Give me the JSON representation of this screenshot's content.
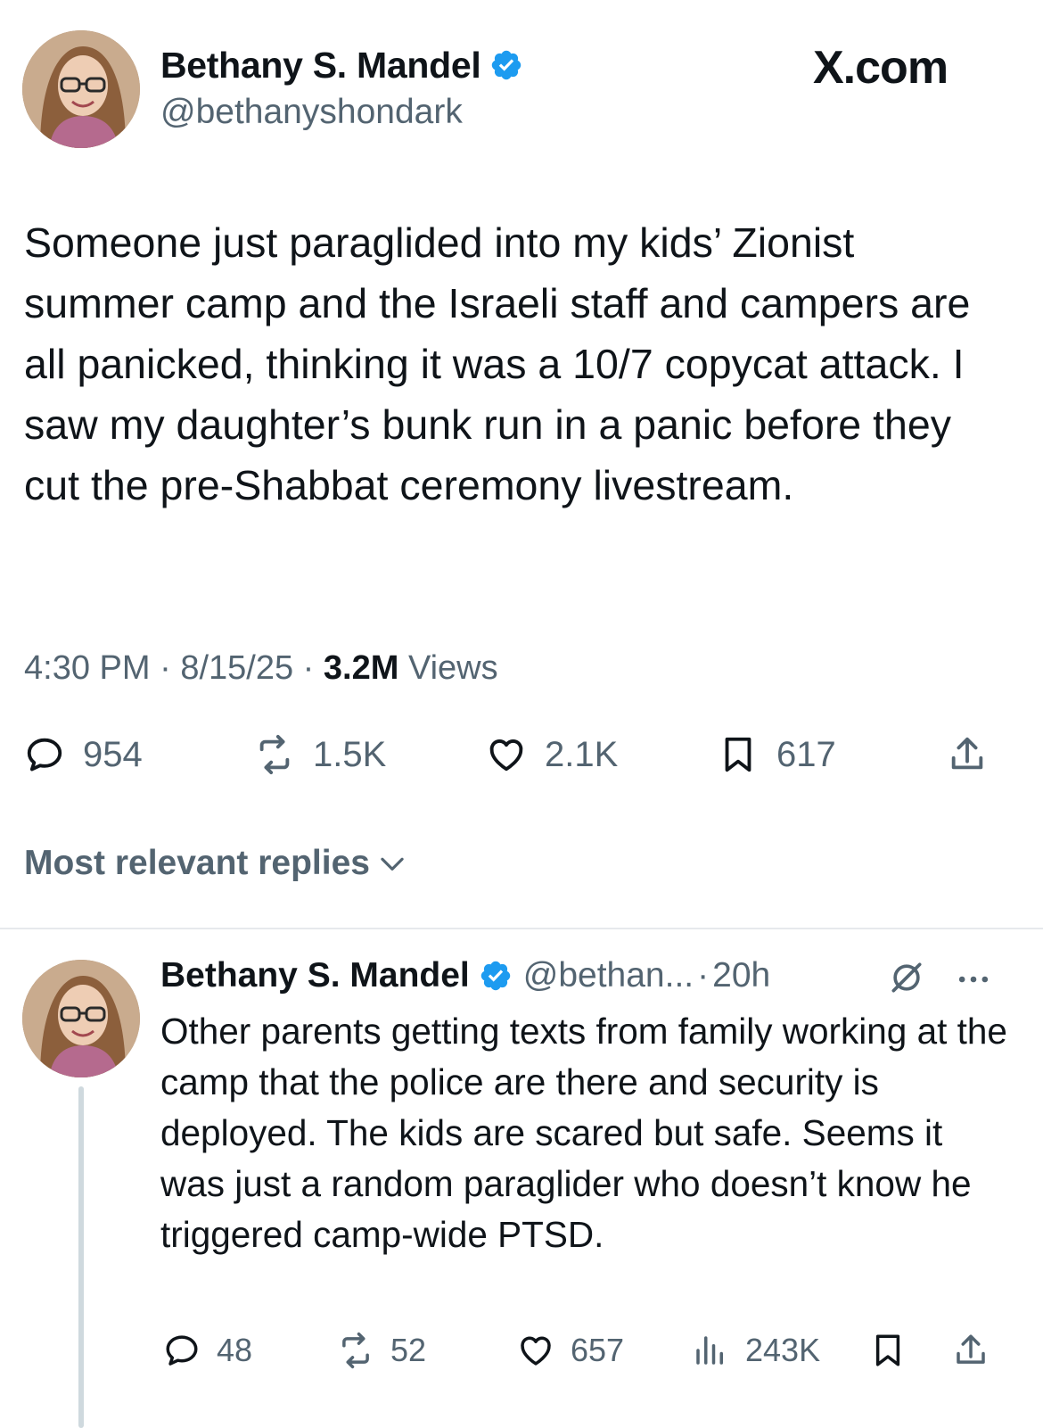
{
  "tweet": {
    "author_name": "Bethany S. Mandel",
    "author_handle": "@bethanyshondark",
    "brand": "X.com",
    "text": "Someone just paraglided into my kids’ Zionist summer camp and the Israeli staff and campers are all panicked, thinking it was a 10/7 copycat attack. I saw my daughter’s bunk run in a panic before they cut the pre-Shabbat ceremony livestream.",
    "time": "4:30 PM",
    "date": "8/15/25",
    "views_count": "3.2M",
    "views_label": "Views",
    "separator": "·",
    "actions": {
      "replies": "954",
      "reposts": "1.5K",
      "likes": "2.1K",
      "bookmarks": "617"
    }
  },
  "replies_section": {
    "label": "Most relevant replies"
  },
  "reply": {
    "author_name": "Bethany S. Mandel",
    "author_handle": "@bethan...",
    "age": "20h",
    "text": "Other parents getting texts from family working at the camp that the police are there and security is deployed. The kids are scared but safe. Seems it was just a random paraglider who doesn’t know he triggered camp-wide PTSD.",
    "actions": {
      "replies": "48",
      "reposts": "52",
      "likes": "657",
      "views": "243K"
    }
  },
  "colors": {
    "verified_blue": "#1d9bf0",
    "muted_gray": "#536471",
    "text": "#0f1419",
    "thread_line": "#cfd9de"
  },
  "icons": [
    "verified-badge-icon",
    "reply-icon",
    "repost-icon",
    "like-icon",
    "bookmark-icon",
    "share-icon",
    "chevron-down-icon",
    "grok-icon",
    "more-icon",
    "views-icon"
  ]
}
